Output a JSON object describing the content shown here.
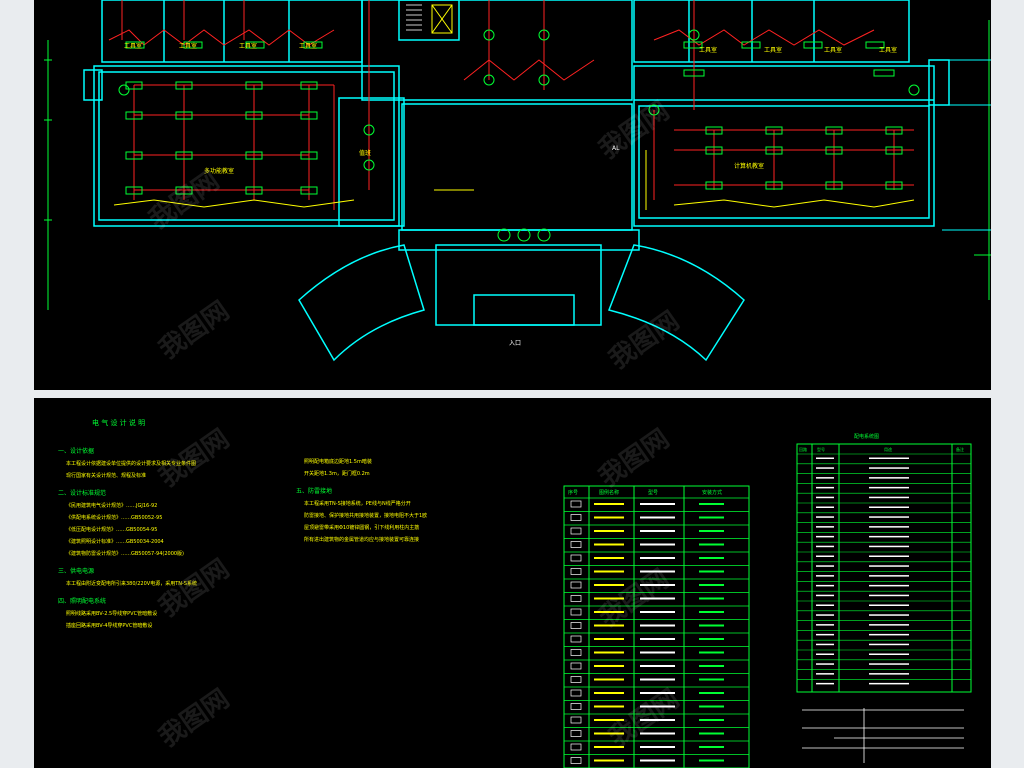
{
  "plan": {
    "room_labels": [
      "工具室",
      "工具室",
      "工具室",
      "工具室",
      "工具室",
      "工具室",
      "工具室",
      "工具室",
      "多功能教室",
      "计算机教室",
      "值班"
    ],
    "panel_label": "AL",
    "entry_label": "入口"
  },
  "notes": {
    "title": "电 气 设 计 说 明",
    "sections": [
      {
        "heading": "一、设计依据",
        "lines": [
          "本工程设计依据建设单位提供的设计要求及相关专业条件图",
          "现行国家有关设计规范、规程及标准"
        ]
      },
      {
        "heading": "二、设计标准规范",
        "lines": [
          "《民用建筑电气设计规范》……JGJ16-92",
          "《供配电系统设计规范》……GB50052-95",
          "《低压配电设计规范》……GB50054-95",
          "《建筑照明设计标准》……GB50034-2004",
          "《建筑物防雷设计规范》……GB50057-94(2000版)"
        ]
      },
      {
        "heading": "三、供电电源",
        "lines": [
          "本工程由附近变配电所引来380/220V电源，采用TN-S系统"
        ]
      },
      {
        "heading": "四、照明配电系统",
        "lines": [
          "照明线路采用BV-2.5导线穿PVC管暗敷设",
          "插座回路采用BV-4导线穿PVC管暗敷设"
        ]
      }
    ],
    "col2": [
      {
        "heading": "",
        "lines": [
          "照明配电箱底边距地1.5m暗装",
          "开关距地1.3m，距门框0.2m"
        ]
      },
      {
        "heading": "五、防雷接地",
        "lines": [
          "本工程采用TN-S接地系统，PE线与N线严格分开",
          "防雷接地、保护接地共用接地装置，接地电阻不大于1欧",
          "屋顶避雷带采用Φ10镀锌圆钢，引下线利用柱内主筋",
          "所有进出建筑物的金属管道均应与接地装置可靠连接"
        ]
      }
    ],
    "legend": {
      "headers": [
        "序号",
        "图例名称",
        "型号",
        "安装方式"
      ],
      "row_count": 20
    },
    "system_table": {
      "title": "配电系统图",
      "headers": [
        "回路",
        "型号",
        "用途",
        "备注"
      ],
      "row_count": 24
    }
  },
  "watermark": "我图网"
}
